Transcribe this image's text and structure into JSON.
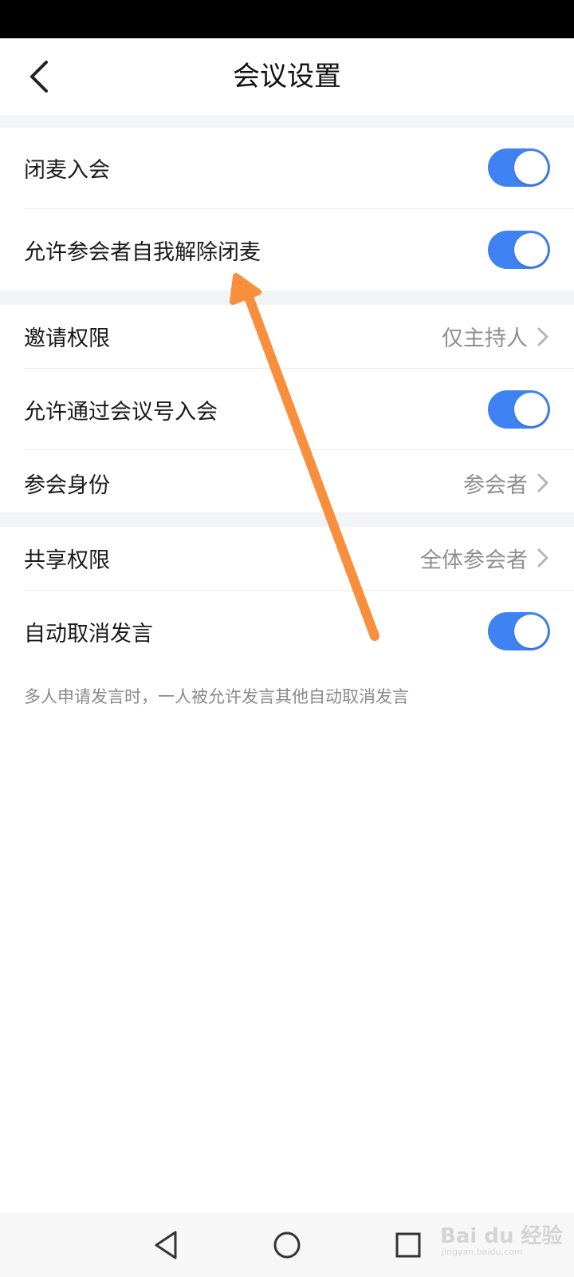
{
  "header": {
    "title": "会议设置"
  },
  "settings": {
    "mute_on_join": {
      "label": "闭麦入会",
      "enabled": true
    },
    "allow_self_unmute": {
      "label": "允许参会者自我解除闭麦",
      "enabled": true
    },
    "invite_permission": {
      "label": "邀请权限",
      "value": "仅主持人"
    },
    "allow_join_by_id": {
      "label": "允许通过会议号入会",
      "enabled": true
    },
    "participant_role": {
      "label": "参会身份",
      "value": "参会者"
    },
    "share_permission": {
      "label": "共享权限",
      "value": "全体参会者"
    },
    "auto_cancel_speak": {
      "label": "自动取消发言",
      "enabled": true,
      "hint": "多人申请发言时，一人被允许发言其他自动取消发言"
    }
  },
  "watermark": {
    "text": "Bai du 经验",
    "url": "jingyan.baidu.com"
  },
  "colors": {
    "toggle_on": "#3f82f1",
    "annotation_arrow": "#f98f3c",
    "section_gap": "#f3f4f6",
    "secondary_text": "#8f8f8f"
  },
  "icons": {
    "back": "chevron-left-icon",
    "chevron": "chevron-right-icon",
    "sys_back": "triangle-back-icon",
    "sys_home": "circle-home-icon",
    "sys_recents": "square-recents-icon"
  }
}
